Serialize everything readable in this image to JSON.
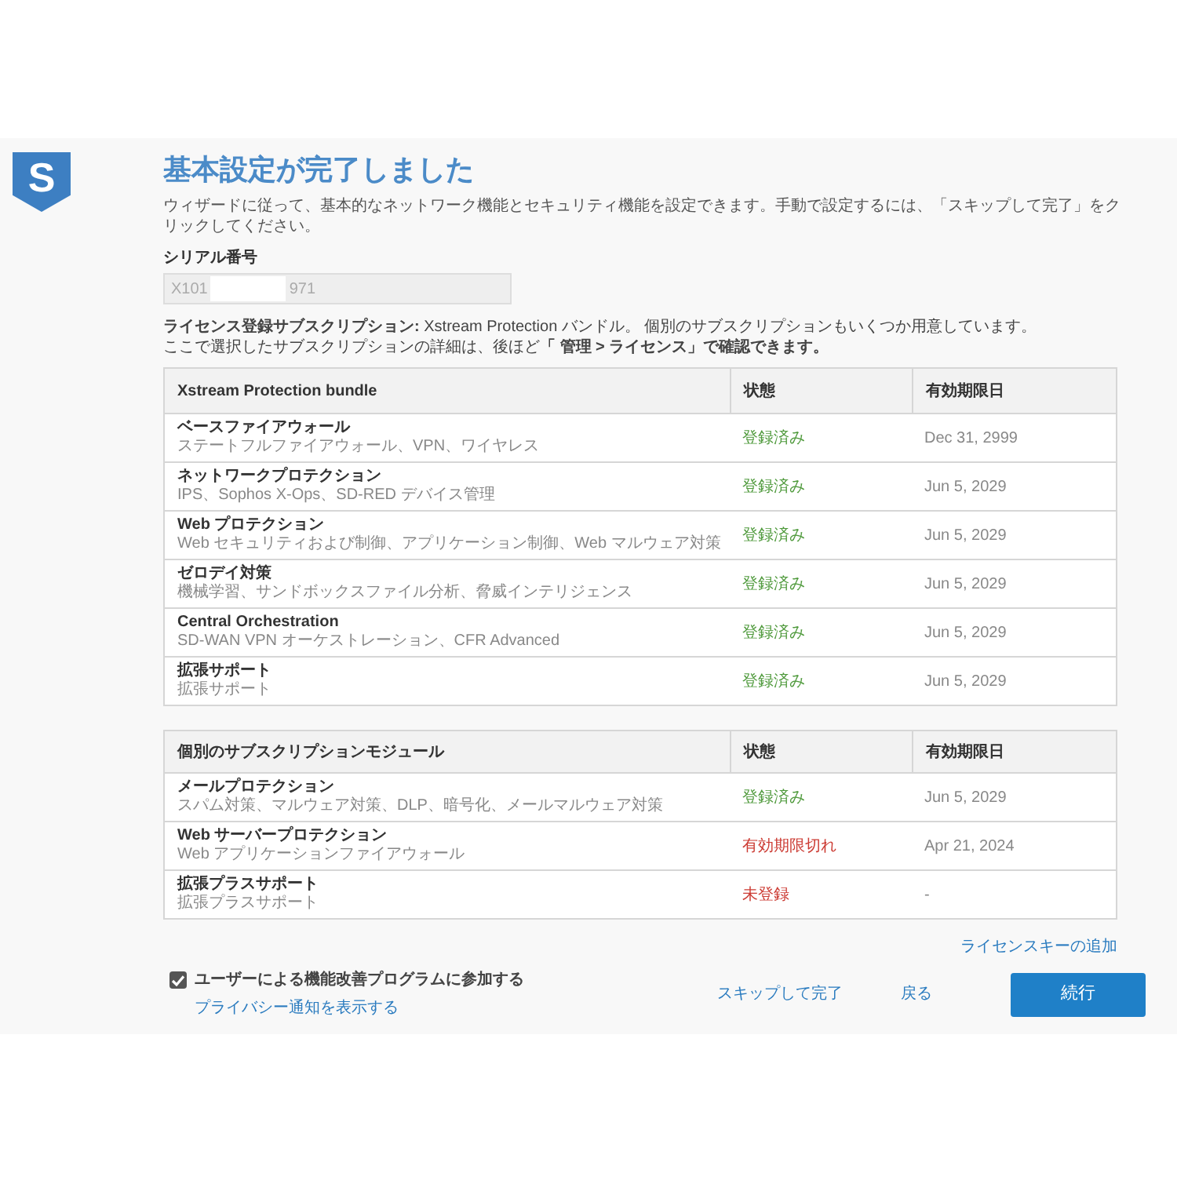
{
  "logo": {
    "letter": "S"
  },
  "header": {
    "title": "基本設定が完了しました",
    "description": "ウィザードに従って、基本的なネットワーク機能とセキュリティ機能を設定できます。手動で設定するには、「スキップして完了」をクリックしてください。"
  },
  "serial": {
    "label": "シリアル番号",
    "value_start": "X101",
    "redacted": true,
    "value_end": "971"
  },
  "license_info": [
    "**ライセンス登録サブスクリプション:** Xstream Protection バンドル。 個別のサブスクリプションもいくつか用意しています。",
    "ここで選択したサブスクリプションの詳細は、後ほど**「 管理 > ライセンス」で確認できます。**"
  ],
  "tables": [
    {
      "columns": [
        "Xstream Protection bundle",
        "状態",
        "有効期限日"
      ],
      "rows": [
        {
          "name": "ベースファイアウォール",
          "description": "ステートフルファイアウォール、VPN、ワイヤレス",
          "status": {
            "text": "登録済み",
            "kind": "ok"
          },
          "expiry": "Dec 31, 2999"
        },
        {
          "name": "ネットワークプロテクション",
          "description": "IPS、Sophos X-Ops、SD-RED デバイス管理",
          "status": {
            "text": "登録済み",
            "kind": "ok"
          },
          "expiry": "Jun 5, 2029"
        },
        {
          "name": "Web プロテクション",
          "description": "Web セキュリティおよび制御、アプリケーション制御、Web マルウェア対策",
          "status": {
            "text": "登録済み",
            "kind": "ok"
          },
          "expiry": "Jun 5, 2029"
        },
        {
          "name": "ゼロデイ対策",
          "description": "機械学習、サンドボックスファイル分析、脅威インテリジェンス",
          "status": {
            "text": "登録済み",
            "kind": "ok"
          },
          "expiry": "Jun 5, 2029"
        },
        {
          "name": "Central Orchestration",
          "description": "SD-WAN VPN オーケストレーション、CFR Advanced",
          "status": {
            "text": "登録済み",
            "kind": "ok"
          },
          "expiry": "Jun 5, 2029"
        },
        {
          "name": "拡張サポート",
          "description": "拡張サポート",
          "status": {
            "text": "登録済み",
            "kind": "ok"
          },
          "expiry": "Jun 5, 2029"
        }
      ]
    },
    {
      "columns": [
        "個別のサブスクリプションモジュール",
        "状態",
        "有効期限日"
      ],
      "rows": [
        {
          "name": "メールプロテクション",
          "description": "スパム対策、マルウェア対策、DLP、暗号化、メールマルウェア対策",
          "status": {
            "text": "登録済み",
            "kind": "ok"
          },
          "expiry": "Jun 5, 2029"
        },
        {
          "name": "Web サーバープロテクション",
          "description": "Web アプリケーションファイアウォール",
          "status": {
            "text": "有効期限切れ",
            "kind": "error"
          },
          "expiry": "Apr 21, 2024"
        },
        {
          "name": "拡張プラスサポート",
          "description": "拡張プラスサポート",
          "status": {
            "text": "未登録",
            "kind": "error"
          },
          "expiry": "-"
        }
      ]
    }
  ],
  "add_license_key_link": "ライセンスキーの追加",
  "program_checkbox": {
    "label": "ユーザーによる機能改善プログラムに参加する",
    "checked": true
  },
  "privacy_link": "プライバシー通知を表示する",
  "buttons": [
    {
      "label": "スキップして完了",
      "kind": "link"
    },
    {
      "label": "戻る",
      "kind": "link"
    },
    {
      "label": "続行",
      "kind": "primary"
    }
  ]
}
